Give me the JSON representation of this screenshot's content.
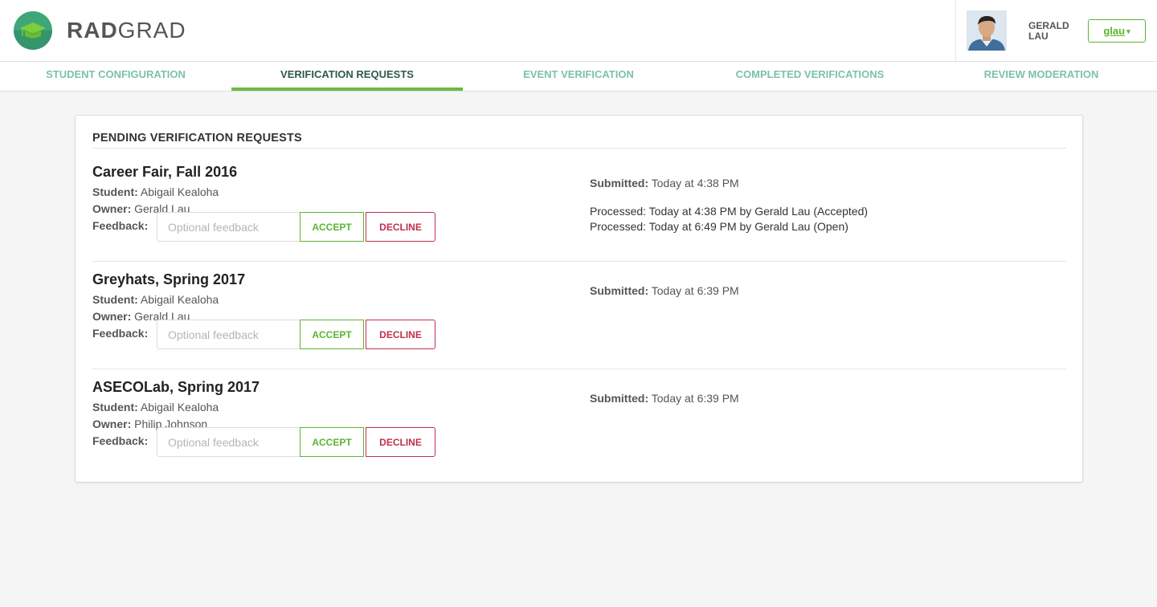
{
  "brand": {
    "part1": "RAD",
    "part2": "GRAD"
  },
  "user": {
    "first_name": "GERALD",
    "last_name": "LAU",
    "username": "glau",
    "caret": "▾"
  },
  "tabs": [
    {
      "label": "STUDENT CONFIGURATION",
      "active": false
    },
    {
      "label": "VERIFICATION REQUESTS",
      "active": true
    },
    {
      "label": "EVENT VERIFICATION",
      "active": false
    },
    {
      "label": "COMPLETED VERIFICATIONS",
      "active": false
    },
    {
      "label": "REVIEW MODERATION",
      "active": false
    }
  ],
  "colors": {
    "accent": "#5cb531",
    "decline": "#c0304a",
    "tab": "#7cc2a6",
    "tab_active": "#2f5b47",
    "logo": "#3fa67a"
  },
  "card": {
    "title": "PENDING VERIFICATION REQUESTS"
  },
  "labels": {
    "student": "Student:",
    "owner": "Owner:",
    "feedback": "Feedback:",
    "submitted": "Submitted:",
    "placeholder": "Optional feedback",
    "accept": "ACCEPT",
    "decline": "DECLINE"
  },
  "requests": [
    {
      "title": "Career Fair, Fall 2016",
      "student": "Abigail Kealoha",
      "owner": "Gerald Lau",
      "submitted": "Today at 4:38 PM",
      "processed": [
        "Processed: Today at 4:38 PM by Gerald Lau (Accepted)",
        "Processed: Today at 6:49 PM by Gerald Lau (Open)"
      ]
    },
    {
      "title": "Greyhats, Spring 2017",
      "student": "Abigail Kealoha",
      "owner": "Gerald Lau",
      "submitted": "Today at 6:39 PM",
      "processed": []
    },
    {
      "title": "ASECOLab, Spring 2017",
      "student": "Abigail Kealoha",
      "owner": "Philip Johnson",
      "submitted": "Today at 6:39 PM",
      "processed": []
    }
  ]
}
